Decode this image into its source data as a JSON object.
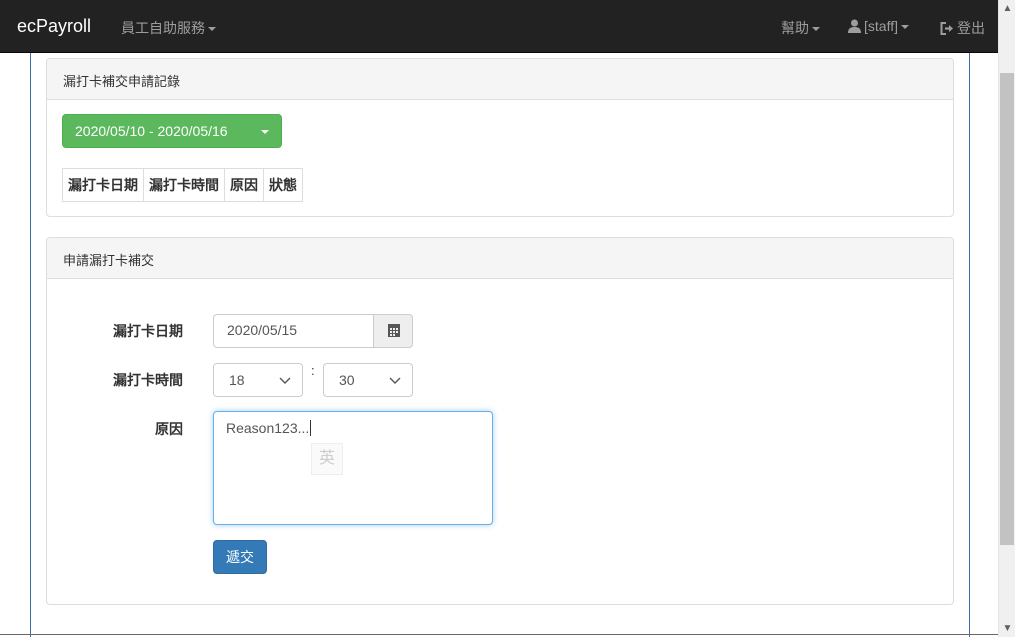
{
  "navbar": {
    "brand": "ecPayroll",
    "menu_self_service": "員工自助服務",
    "menu_help": "幫助",
    "user_label": "[staff]",
    "logout_label": "登出",
    "background_color": "#222222"
  },
  "records_panel": {
    "title": "漏打卡補交申請記錄",
    "date_range": "2020/05/10 - 2020/05/16",
    "columns": [
      "漏打卡日期",
      "漏打卡時間",
      "原因",
      "狀態"
    ]
  },
  "apply_panel": {
    "title": "申請漏打卡補交",
    "date_label": "漏打卡日期",
    "date_value": "2020/05/15",
    "time_label": "漏打卡時間",
    "hour_value": "18",
    "time_separator": ":",
    "minute_value": "30",
    "reason_label": "原因",
    "reason_value": "Reason123...",
    "ime_indicator": "英",
    "submit_label": "遞交"
  },
  "colors": {
    "success": "#5cb85c",
    "primary": "#337ab7",
    "focus": "#66afe9"
  }
}
